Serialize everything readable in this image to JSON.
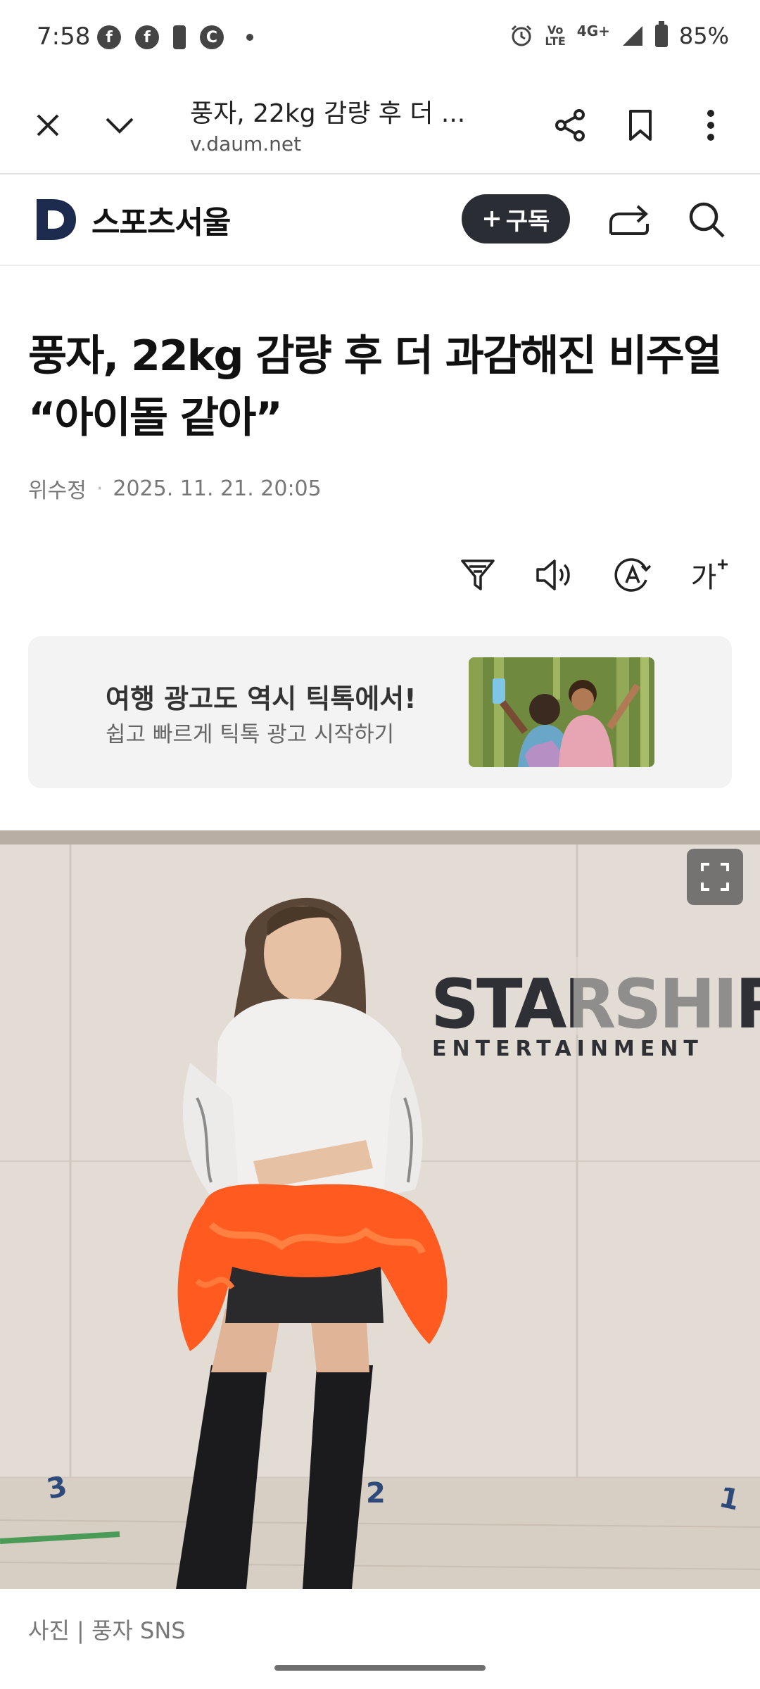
{
  "status_bar": {
    "time": "7:58",
    "letter_c": "C",
    "network": "4G+",
    "lte_top": "Vo",
    "lte_bottom": "LTE",
    "battery": "85%"
  },
  "browser": {
    "page_title": "풍자, 22kg 감량 후 더 ...",
    "url": "v.daum.net"
  },
  "site": {
    "logo_letter": "D",
    "name": "스포츠서울",
    "subscribe_label": "구독"
  },
  "article": {
    "headline": "풍자, 22kg 감량 후 더 과감해진 비주얼 “아이돌 같아”",
    "author": "위수정",
    "separator": "·",
    "date": "2025. 11. 21. 20:05",
    "font_tool_label": "가"
  },
  "ad": {
    "title": "여행 광고도 역시 틱톡에서!",
    "subtitle": "쉽고 빠르게 틱톡 광고 시작하기"
  },
  "photo": {
    "sign_top": "STARSHIP",
    "sign_bottom": "ENTERTAINMENT",
    "floor_marks": [
      "3",
      "2",
      "1"
    ],
    "caption": "사진 | 풍자 SNS"
  }
}
